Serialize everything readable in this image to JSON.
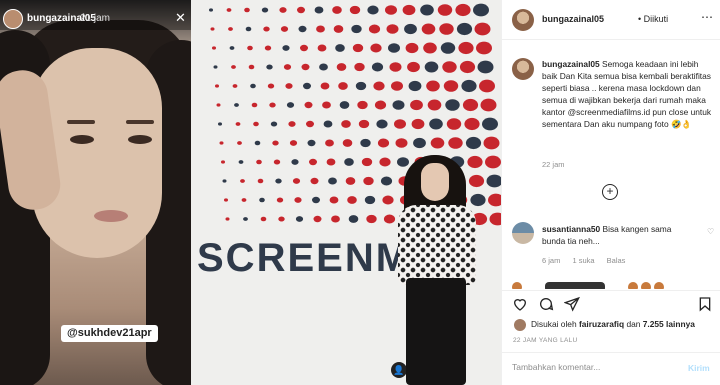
{
  "story": {
    "username": "bungazainal05",
    "time": "21 jam",
    "close_icon": "close-icon",
    "mention": "@sukhdev21apr"
  },
  "photo": {
    "wall_text": "SCREENME"
  },
  "post": {
    "username": "bungazainal05",
    "separator": "•",
    "follow_status": "Diikuti",
    "more_icon": "more-icon",
    "caption_text": "Semoga keadaan ini lebih baik Dan Kita semua bisa kembali beraktifitas seperti biasa .. kerena masa lockdown dan semua di wajibkan bekerja dari rumah maka kantor @screenmediafilms.id pun close untuk sementara Dan aku numpang foto 🤣👌",
    "caption_time": "22 jam",
    "load_more": "+",
    "comment": {
      "username": "susantianna50",
      "text": "Bisa kangen sama bunda tia neh...",
      "time": "6 jam",
      "likes": "1 suka",
      "reply": "Balas"
    },
    "likes_prefix": "Disukai oleh",
    "likes_user": "fairuzarafiq",
    "likes_mid": "dan",
    "likes_count": "7.255 lainnya",
    "post_time": "22 JAM YANG LALU",
    "comment_placeholder": "Tambahkan komentar...",
    "post_button": "Kirim"
  },
  "colors": {
    "accent": "#0095f6",
    "post_button_disabled": "#b2dffc",
    "dot_red": "#c7262d",
    "dot_navy": "#2f3a4a"
  }
}
